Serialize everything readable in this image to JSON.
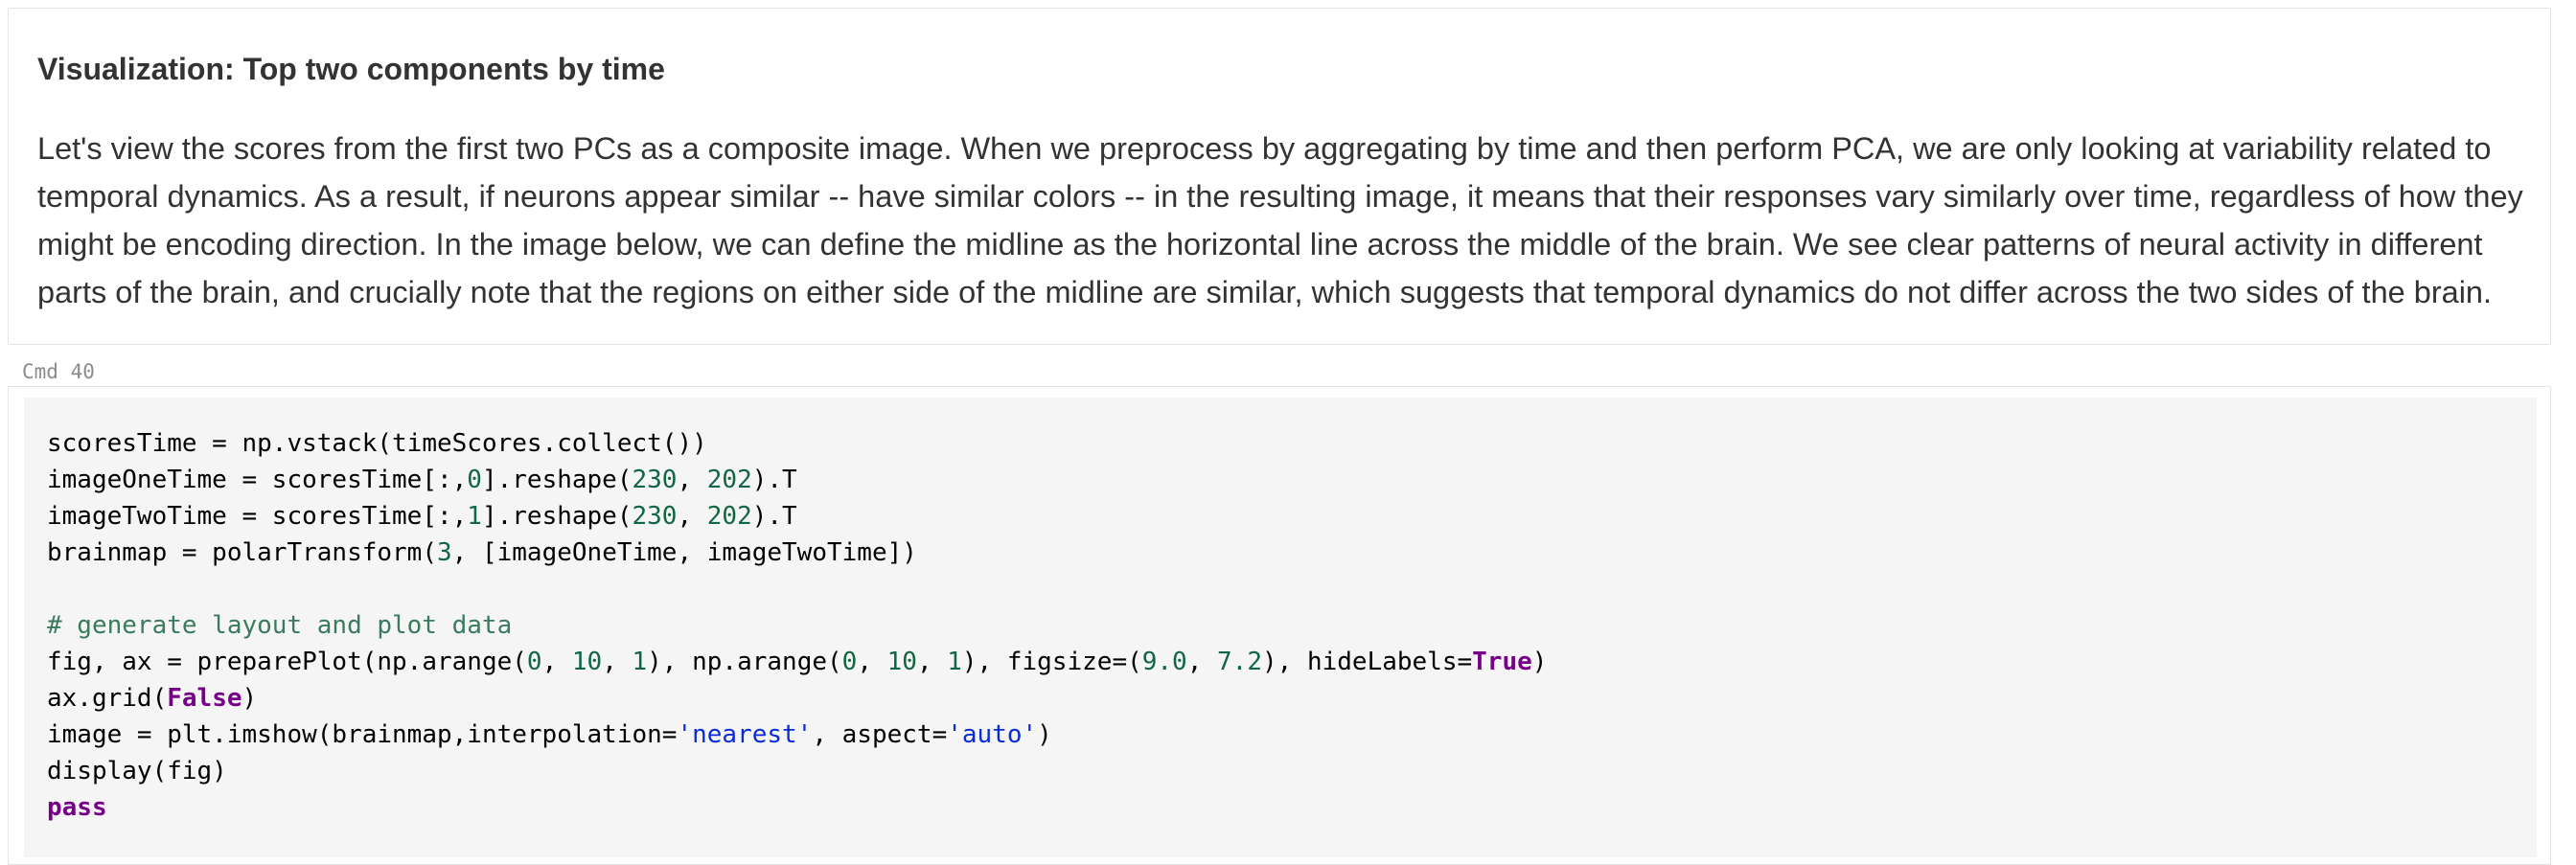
{
  "markdown_cell": {
    "title": "Visualization: Top two components by time",
    "paragraph_lines": [
      "Let's view the scores from the first two PCs as a composite image. When we preprocess by aggregating by time and then perform PCA, we are only looking at variability related to",
      "temporal dynamics. As a result, if neurons appear similar -- have similar colors -- in the resulting image, it means that their responses vary similarly over time, regardless of how they",
      "might be encoding direction. In the image below, we can define the midline as the horizontal line across the middle of the brain. We see clear patterns of neural activity in different",
      "parts of the brain, and crucially note that the regions on either side of the midline are similar, which suggests that temporal dynamics do not differ across the two sides of the brain."
    ]
  },
  "code_cell": {
    "label": "Cmd 40",
    "lines": [
      [
        {
          "t": "scoresTime = np.vstack(timeScores.collect())",
          "k": "plain"
        }
      ],
      [
        {
          "t": "imageOneTime = scoresTime[:,",
          "k": "plain"
        },
        {
          "t": "0",
          "k": "num"
        },
        {
          "t": "].reshape(",
          "k": "plain"
        },
        {
          "t": "230",
          "k": "num"
        },
        {
          "t": ", ",
          "k": "plain"
        },
        {
          "t": "202",
          "k": "num"
        },
        {
          "t": ").T",
          "k": "plain"
        }
      ],
      [
        {
          "t": "imageTwoTime = scoresTime[:,",
          "k": "plain"
        },
        {
          "t": "1",
          "k": "num"
        },
        {
          "t": "].reshape(",
          "k": "plain"
        },
        {
          "t": "230",
          "k": "num"
        },
        {
          "t": ", ",
          "k": "plain"
        },
        {
          "t": "202",
          "k": "num"
        },
        {
          "t": ").T",
          "k": "plain"
        }
      ],
      [
        {
          "t": "brainmap = polarTransform(",
          "k": "plain"
        },
        {
          "t": "3",
          "k": "num"
        },
        {
          "t": ", [imageOneTime, imageTwoTime])",
          "k": "plain"
        }
      ],
      [],
      [
        {
          "t": "# generate layout and plot data",
          "k": "comment"
        }
      ],
      [
        {
          "t": "fig, ax = preparePlot(np.arange(",
          "k": "plain"
        },
        {
          "t": "0",
          "k": "num"
        },
        {
          "t": ", ",
          "k": "plain"
        },
        {
          "t": "10",
          "k": "num"
        },
        {
          "t": ", ",
          "k": "plain"
        },
        {
          "t": "1",
          "k": "num"
        },
        {
          "t": "), np.arange(",
          "k": "plain"
        },
        {
          "t": "0",
          "k": "num"
        },
        {
          "t": ", ",
          "k": "plain"
        },
        {
          "t": "10",
          "k": "num"
        },
        {
          "t": ", ",
          "k": "plain"
        },
        {
          "t": "1",
          "k": "num"
        },
        {
          "t": "), figsize=(",
          "k": "plain"
        },
        {
          "t": "9.0",
          "k": "num"
        },
        {
          "t": ", ",
          "k": "plain"
        },
        {
          "t": "7.2",
          "k": "num"
        },
        {
          "t": "), hideLabels=",
          "k": "plain"
        },
        {
          "t": "True",
          "k": "kw"
        },
        {
          "t": ")",
          "k": "plain"
        }
      ],
      [
        {
          "t": "ax.grid(",
          "k": "plain"
        },
        {
          "t": "False",
          "k": "kw"
        },
        {
          "t": ")",
          "k": "plain"
        }
      ],
      [
        {
          "t": "image = plt.imshow(brainmap,interpolation=",
          "k": "plain"
        },
        {
          "t": "'nearest'",
          "k": "str"
        },
        {
          "t": ", aspect=",
          "k": "plain"
        },
        {
          "t": "'auto'",
          "k": "str"
        },
        {
          "t": ")",
          "k": "plain"
        }
      ],
      [
        {
          "t": "display(fig)",
          "k": "plain"
        }
      ],
      [
        {
          "t": "pass",
          "k": "kw"
        }
      ]
    ]
  },
  "colors": {
    "number": "#116644",
    "keyword": "#770088",
    "string": "#0a2bd6",
    "comment": "#3a7a5f",
    "editor_background": "#f5f5f5"
  }
}
